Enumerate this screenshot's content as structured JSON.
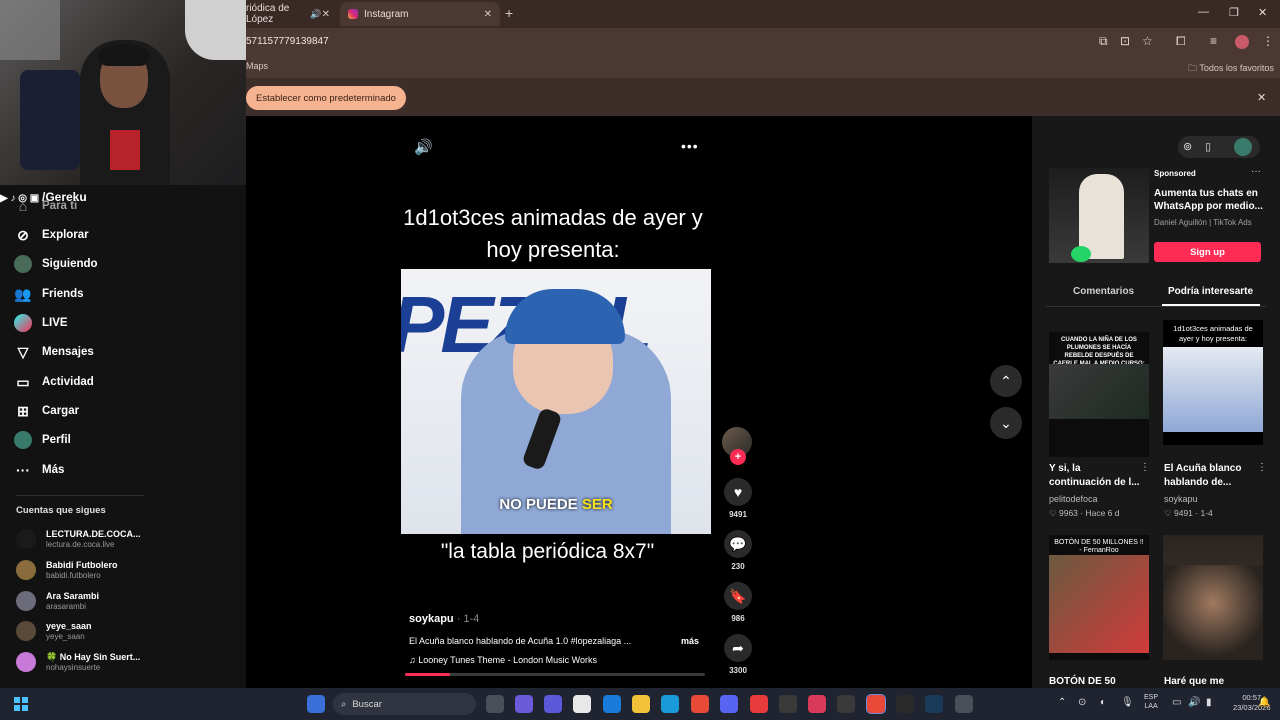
{
  "browser": {
    "tabs": [
      {
        "label": "riódica de López",
        "active": false
      },
      {
        "label": "Instagram",
        "active": true
      }
    ],
    "url": "571157779139847",
    "bookmarks": {
      "maps": "Maps",
      "favorites": "Todos los favoritos"
    },
    "infobar": {
      "set_default": "Establecer como predeterminado"
    }
  },
  "stream": {
    "handle": "/Gereku"
  },
  "sidebar": {
    "items": [
      {
        "label": "Para ti",
        "icon": "home-icon"
      },
      {
        "label": "Explorar",
        "icon": "compass-icon"
      },
      {
        "label": "Siguiendo",
        "icon": "following-icon"
      },
      {
        "label": "Friends",
        "icon": "friends-icon"
      },
      {
        "label": "LIVE",
        "icon": "live-icon"
      },
      {
        "label": "Mensajes",
        "icon": "messages-icon"
      },
      {
        "label": "Actividad",
        "icon": "activity-icon"
      },
      {
        "label": "Cargar",
        "icon": "upload-icon"
      },
      {
        "label": "Perfil",
        "icon": "profile-icon"
      },
      {
        "label": "Más",
        "icon": "more-icon"
      }
    ],
    "following_title": "Cuentas que sigues",
    "accounts": [
      {
        "name": "LECTURA.DE.COCA...",
        "handle": "lectura.de.coca.live",
        "color": "#1a1a1a"
      },
      {
        "name": "Babidi Futbolero",
        "handle": "babidi.futbolero",
        "color": "#8a6b3c"
      },
      {
        "name": "Ara Sarambi",
        "handle": "arasarambi",
        "color": "#6b6b7a"
      },
      {
        "name": "yeye_saan",
        "handle": "yeye_saan",
        "color": "#5a4a3a"
      },
      {
        "name": "🍀 No Hay Sin Suert...",
        "handle": "nohaysinsuerte",
        "color": "#c87ad8"
      }
    ]
  },
  "video": {
    "caption_top": "1d1ot3ces animadas de ayer y hoy presenta:",
    "frame_text": "PEZ AL",
    "subtitle_a": "NO PUEDE",
    "subtitle_b": "SER",
    "caption_bottom": "\"la tabla periódica 8x7\"",
    "author": "soykapu",
    "date": " · 1-4",
    "description": "El Acuña blanco hablando de Acuña 1.0 #lopezaliaga ...",
    "more": "más",
    "music": "♫  Looney Tunes Theme - London Music Works",
    "progress": 0.15,
    "actions": {
      "likes": "9491",
      "comments": "230",
      "saves": "986",
      "shares": "3300"
    }
  },
  "right_panel": {
    "ad": {
      "sponsored": "Sponsored",
      "title": "Aumenta tus chats en WhatsApp por medio...",
      "source": "Daniel Aguillón | TikTok Ads",
      "cta": "Sign up"
    },
    "tabs": {
      "comments": "Comentarios",
      "interesting": "Podría interesarte"
    },
    "videos": [
      {
        "thumb_text": "CUANDO LA NIÑA DE LOS PLUMONES SE HACÍA REBELDE DESPUÉS DE CAERLE MAL A MEDIO CURSO:",
        "title": "Y si, la continuación de l...",
        "author": "pelitodefoca",
        "likes": "9963",
        "age": "Hace 6 d"
      },
      {
        "thumb_text": "1d1ot3ces animadas de ayer y hoy presenta:",
        "title": "El Acuña blanco hablando de...",
        "author": "soykapu",
        "likes": "9491",
        "age": "1-4"
      },
      {
        "thumb_text": "BOTÓN DE 50 MILLONES !! - FernanRoo",
        "title": "BOTÓN DE 50",
        "author": "",
        "likes": "",
        "age": ""
      },
      {
        "thumb_text": "",
        "title": "Haré que me",
        "author": "",
        "likes": "",
        "age": ""
      }
    ]
  },
  "taskbar": {
    "search": "Buscar",
    "lang": "ESP\nLAA",
    "time": "00:57",
    "date": "23/03/2026"
  }
}
